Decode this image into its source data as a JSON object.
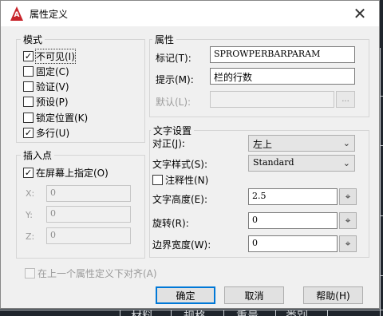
{
  "window": {
    "title": "属性定义",
    "close_glyph": "✕"
  },
  "mode": {
    "legend": "模式",
    "options": [
      {
        "label": "不可见(I)",
        "checked": true
      },
      {
        "label": "固定(C)",
        "checked": false
      },
      {
        "label": "验证(V)",
        "checked": false
      },
      {
        "label": "预设(P)",
        "checked": false
      },
      {
        "label": "锁定位置(K)",
        "checked": false
      },
      {
        "label": "多行(U)",
        "checked": true
      }
    ]
  },
  "insert_point": {
    "legend": "插入点",
    "specify_on_screen": {
      "label": "在屏幕上指定(O)",
      "checked": true
    },
    "x": {
      "label": "X:",
      "value": "0"
    },
    "y": {
      "label": "Y:",
      "value": "0"
    },
    "z": {
      "label": "Z:",
      "value": "0"
    }
  },
  "attribute": {
    "legend": "属性",
    "tag": {
      "label": "标记(T):",
      "value": "SPROWPERBARPARAM"
    },
    "prompt": {
      "label": "提示(M):",
      "value": "栏的行数"
    },
    "default": {
      "label": "默认(L):",
      "value": "",
      "button": "..."
    }
  },
  "text_settings": {
    "legend": "文字设置",
    "justification": {
      "label": "对正(J):",
      "value": "左上"
    },
    "text_style": {
      "label": "文字样式(S):",
      "value": "Standard"
    },
    "annotative": {
      "label": "注释性(N)",
      "checked": false
    },
    "text_height": {
      "label": "文字高度(E):",
      "value": "2.5"
    },
    "rotation": {
      "label": "旋转(R):",
      "value": "0"
    },
    "boundary_width": {
      "label": "边界宽度(W):",
      "value": "0"
    }
  },
  "align_below": {
    "label": "在上一个属性定义下对齐(A)",
    "checked": false
  },
  "buttons": {
    "ok": "确定",
    "cancel": "取消",
    "help": "帮助(H)"
  },
  "background": {
    "labels": [
      "材料",
      "规格",
      "重量",
      "类别"
    ]
  }
}
